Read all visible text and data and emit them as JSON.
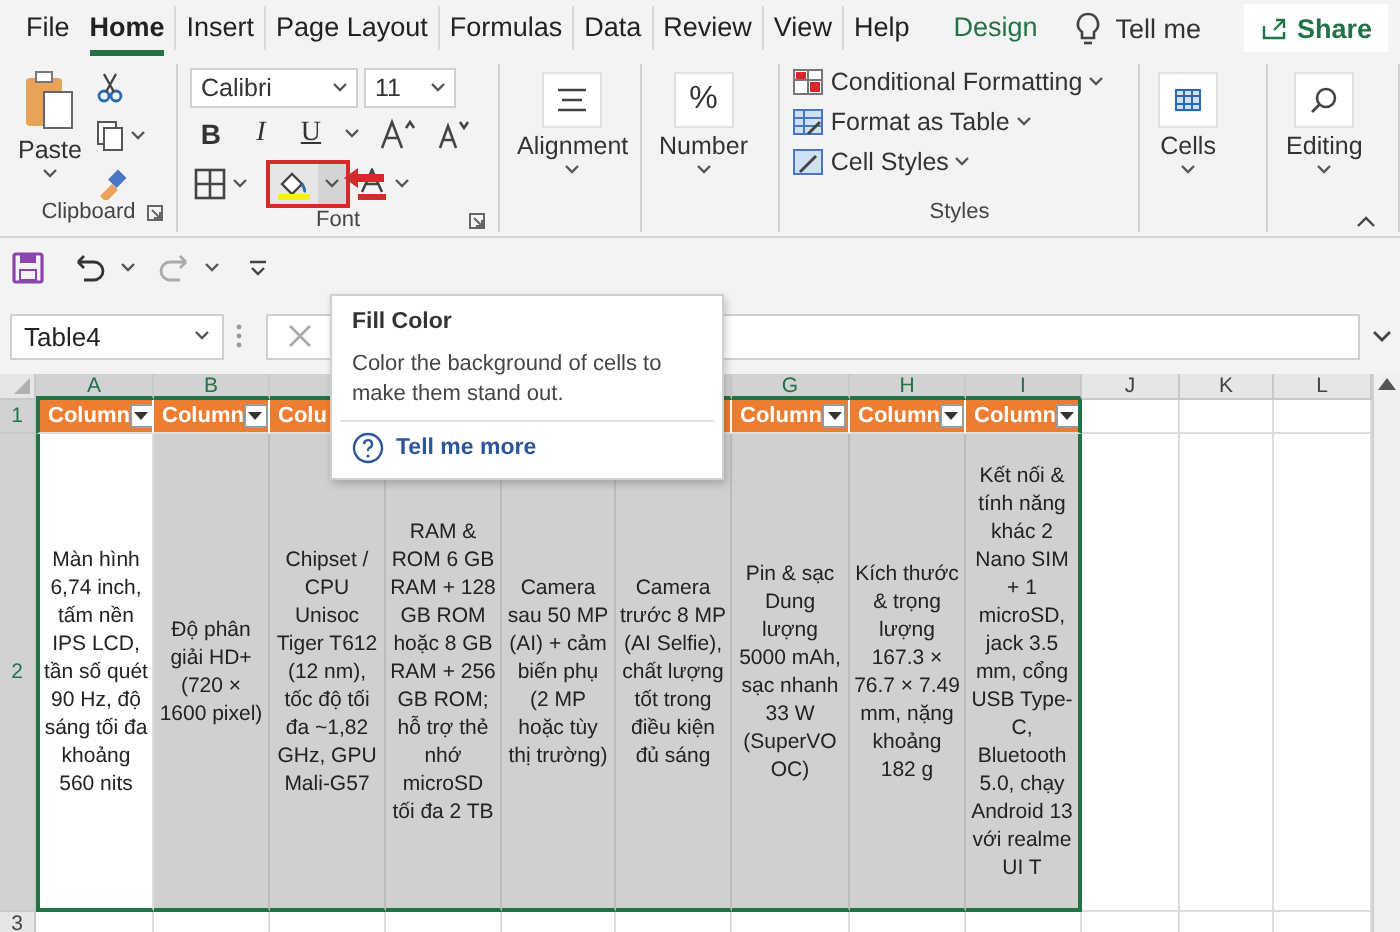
{
  "menu_tabs": [
    {
      "label": "File",
      "selected": false,
      "contextual": false
    },
    {
      "label": "Home",
      "selected": true,
      "contextual": false
    },
    {
      "label": "Insert",
      "selected": false,
      "contextual": false
    },
    {
      "label": "Page Layout",
      "selected": false,
      "contextual": false
    },
    {
      "label": "Formulas",
      "selected": false,
      "contextual": false
    },
    {
      "label": "Data",
      "selected": false,
      "contextual": false
    },
    {
      "label": "Review",
      "selected": false,
      "contextual": false
    },
    {
      "label": "View",
      "selected": false,
      "contextual": false
    },
    {
      "label": "Help",
      "selected": false,
      "contextual": false
    },
    {
      "label": "Design",
      "selected": false,
      "contextual": true
    }
  ],
  "tell_me": "Tell me",
  "share": "Share",
  "ribbon": {
    "clipboard": {
      "paste": "Paste",
      "label": "Clipboard"
    },
    "font": {
      "name": "Calibri",
      "size": "11",
      "bold": "B",
      "italic": "I",
      "underline": "U",
      "label": "Font"
    },
    "alignment": {
      "label": "Alignment"
    },
    "number": {
      "symbol": "%",
      "label": "Number"
    },
    "styles": {
      "items": [
        "Conditional Formatting",
        "Format as Table",
        "Cell Styles"
      ],
      "label": "Styles"
    },
    "cells": {
      "label": "Cells"
    },
    "editing": {
      "label": "Editing"
    }
  },
  "name_box": "Table4",
  "tooltip": {
    "title": "Fill Color",
    "text": "Color the background of cells to make them stand out.",
    "link": "Tell me more"
  },
  "columns": [
    {
      "letter": "A",
      "header": "Column"
    },
    {
      "letter": "B",
      "header": "Column"
    },
    {
      "header": "Colu"
    },
    null,
    null,
    null,
    {
      "letter": "G",
      "header": "Column"
    },
    {
      "letter": "H",
      "header": "Column"
    },
    {
      "letter": "I",
      "header": "Column"
    },
    {
      "letter": "J"
    },
    {
      "letter": "K"
    },
    {
      "letter": "L"
    }
  ],
  "rows": [
    {
      "number": "1"
    },
    {
      "number": "2",
      "cells": [
        {
          "text": "Màn hình 6,74 inch, tấm nền IPS LCD, tần số quét 90 Hz, độ sáng tối đa khoảng 560 nits",
          "shaded": false
        },
        {
          "text": "Độ phân giải HD+ (720 × 1600 pixel)",
          "shaded": true
        },
        {
          "text": "Chipset / CPU Unisoc Tiger T612 (12 nm), tốc độ tối đa ~1,82 GHz, GPU Mali-G57",
          "shaded": true
        },
        {
          "text": "RAM & ROM 6 GB RAM + 128 GB ROM hoặc 8 GB RAM + 256 GB ROM; hỗ trợ thẻ nhớ microSD tối đa 2 TB",
          "shaded": true
        },
        {
          "text": "Camera sau 50 MP (AI) + cảm biến phụ (2 MP hoặc tùy thị trường)",
          "shaded": true
        },
        {
          "text": "Camera trước 8 MP (AI Selfie), chất lượng tốt trong điều kiện đủ sáng",
          "shaded": true
        },
        {
          "text": "Pin & sạc Dung lượng 5000 mAh, sạc nhanh 33 W (SuperVOOC)",
          "shaded": true
        },
        {
          "text": "Kích thước & trọng lượng 167.3 × 76.7 × 7.49 mm, nặng khoảng 182 g",
          "shaded": true
        },
        {
          "text": "Kết nối & tính năng khác 2 Nano SIM + 1 microSD, jack 3.5 mm, cổng USB Type-C, Bluetooth 5.0, chạy Android 13 với realme UI T",
          "shaded": true
        }
      ]
    },
    {
      "number": "3"
    }
  ]
}
